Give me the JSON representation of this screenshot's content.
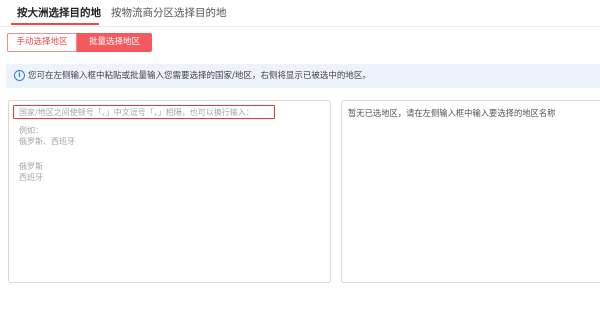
{
  "tabs": {
    "active_label": "按大洲选择目的地",
    "inactive_label": "按物流商分区选择目的地"
  },
  "mode": {
    "manual_label": "手动选择地区",
    "batch_label": "批量选择地区"
  },
  "notice": {
    "icon": "info-icon",
    "text": "您可在左侧输入框中粘贴或批量输入您需要选择的国家/地区，右侧将显示已被选中的地区。"
  },
  "input_panel": {
    "placeholder_line1": "国家/地区之间使顿号「、」中文逗号「，」相隔，也可以换行输入：",
    "placeholder_example_label": "例如：",
    "placeholder_example_inline": "俄罗斯、西班牙",
    "placeholder_example_line_a": "俄罗斯",
    "placeholder_example_line_b": "西班牙"
  },
  "result_panel": {
    "empty_text": "暂无已选地区，请在左侧输入框中输入要选择的地区名称"
  },
  "colors": {
    "accent": "#f45a5d",
    "highlight_border": "#e03c3f",
    "notice_bg": "#edf3fb",
    "info_blue": "#3a7bd5"
  }
}
